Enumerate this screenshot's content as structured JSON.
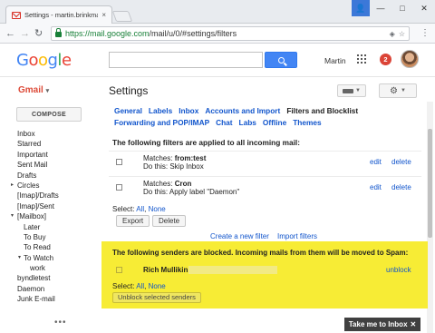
{
  "browser": {
    "tab_title": "Settings - martin.brinkma",
    "tab_close": "×",
    "url_host": "https://mail.google.com",
    "url_path": "/mail/u/0/#settings/filters",
    "back": "←",
    "forward": "→",
    "reload": "↻",
    "window_controls": [
      "—",
      "□",
      "✕"
    ],
    "menu": "⋮"
  },
  "header": {
    "logo_letters": [
      "G",
      "o",
      "o",
      "g",
      "l",
      "e"
    ],
    "username": "Martin",
    "notification_count": "2"
  },
  "gmail": {
    "label": "Gmail",
    "caret": "▾",
    "settings_title": "Settings"
  },
  "sidebar": {
    "compose": "COMPOSE",
    "items": [
      {
        "label": "Inbox",
        "level": 0
      },
      {
        "label": "Starred",
        "level": 0
      },
      {
        "label": "Important",
        "level": 0
      },
      {
        "label": "Sent Mail",
        "level": 0
      },
      {
        "label": "Drafts",
        "level": 0
      },
      {
        "label": "Circles",
        "level": 0,
        "arrow": "▸"
      },
      {
        "label": "[Imap]/Drafts",
        "level": 0
      },
      {
        "label": "[Imap]/Sent",
        "level": 0
      },
      {
        "label": "[Mailbox]",
        "level": 0,
        "arrow": "▾"
      },
      {
        "label": "Later",
        "level": 1
      },
      {
        "label": "To Buy",
        "level": 1
      },
      {
        "label": "To Read",
        "level": 1
      },
      {
        "label": "To Watch",
        "level": 1,
        "arrow": "▾"
      },
      {
        "label": "work",
        "level": 2
      },
      {
        "label": "byndletest",
        "level": 0
      },
      {
        "label": "Daemon",
        "level": 0
      },
      {
        "label": "Junk E-mail",
        "level": 0
      }
    ],
    "more": "•••"
  },
  "settings_tabs": {
    "row1": [
      "General",
      "Labels",
      "Inbox",
      "Accounts and Import",
      "Filters and Blocklist"
    ],
    "row2": [
      "Forwarding and POP/IMAP",
      "Chat",
      "Labs",
      "Offline",
      "Themes"
    ],
    "active": "Filters and Blocklist"
  },
  "filters": {
    "heading": "The following filters are applied to all incoming mail:",
    "rows": [
      {
        "matches_prefix": "Matches: ",
        "matches": "from:test",
        "action": "Do this: Skip Inbox",
        "edit": "edit",
        "delete": "delete"
      },
      {
        "matches_prefix": "Matches: ",
        "matches": "Cron",
        "action": "Do this: Apply label \"Daemon\"",
        "edit": "edit",
        "delete": "delete"
      }
    ],
    "select_prefix": "Select: ",
    "select_all": "All",
    "select_none": "None",
    "export_btn": "Export",
    "delete_btn": "Delete",
    "create_link": "Create a new filter",
    "import_link": "Import filters"
  },
  "blocked": {
    "heading": "The following senders are blocked. Incoming mails from them will be moved to Spam:",
    "sender": "Rich Mullikin",
    "unblock": "unblock",
    "select_prefix": "Select: ",
    "select_all": "All",
    "select_none": "None",
    "unblock_btn": "Unblock selected senders",
    "highlight_color": "#f7ec35"
  },
  "footer": {
    "inbox_button": "Take me to Inbox",
    "inbox_close": "✕"
  }
}
